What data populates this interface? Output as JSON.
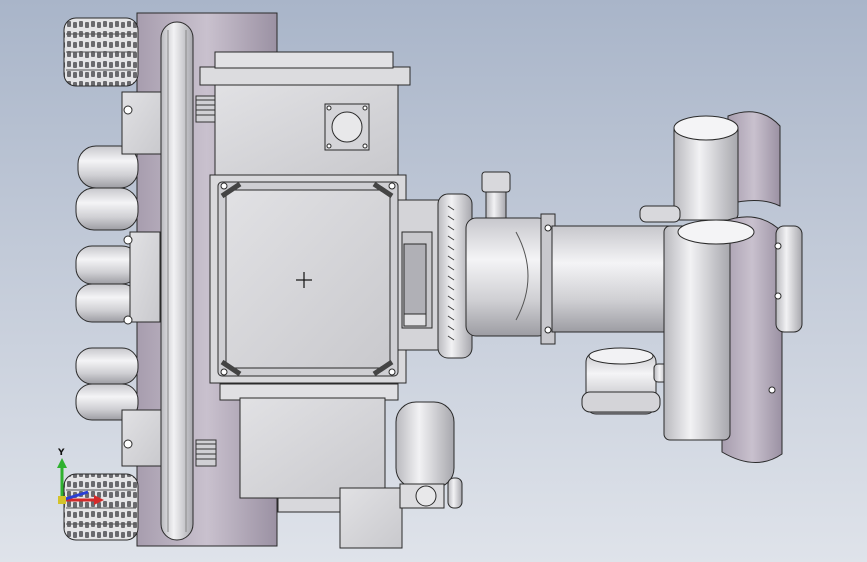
{
  "viewport": {
    "background_top": "#a9b5c9",
    "background_bottom": "#dfe3ea"
  },
  "model": {
    "body_color": "#d6d6d9",
    "shade_color": "#b7b7bc",
    "accent_color": "#9a8fa2",
    "line_color": "#2a2a2a"
  },
  "triad": {
    "y_label": "Y",
    "x_color": "#d42a2a",
    "y_color": "#2fb12f",
    "z_color": "#2a3fd4"
  }
}
